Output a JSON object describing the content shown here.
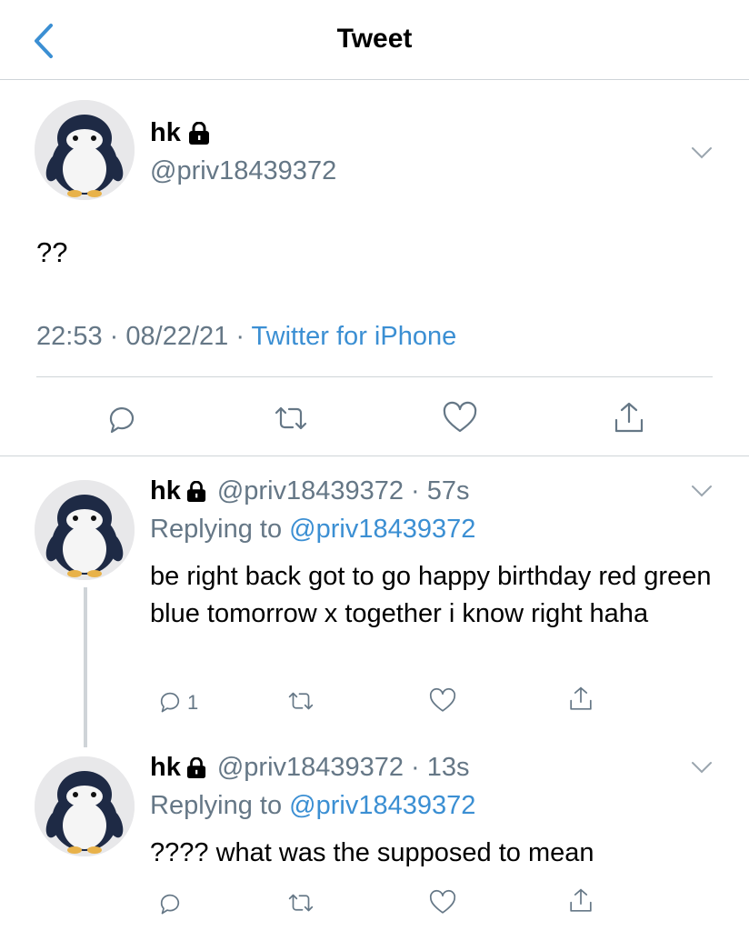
{
  "header": {
    "title": "Tweet",
    "back_icon": "chevron-left-icon",
    "accent_color": "#3b8fd3"
  },
  "main_tweet": {
    "name": "hk",
    "handle": "@priv18439372",
    "text": "??",
    "time": "22:53",
    "date": "08/22/21",
    "source": "Twitter for iPhone",
    "dot": "·",
    "protected_icon": "lock-icon",
    "actions": [
      "reply-icon",
      "retweet-icon",
      "like-icon",
      "share-icon"
    ]
  },
  "replies": [
    {
      "name": "hk",
      "handle": "@priv18439372",
      "dot": "·",
      "age": "57s",
      "replying_label": "Replying to",
      "replying_to": "@priv18439372",
      "text": "be right back got to go happy birthday red green blue tomorrow x together i know right haha",
      "reply_count": "1"
    },
    {
      "name": "hk",
      "handle": "@priv18439372",
      "dot": "·",
      "age": "13s",
      "replying_label": "Replying to",
      "replying_to": "@priv18439372",
      "text": "???? what was the supposed to mean",
      "reply_count": ""
    }
  ]
}
